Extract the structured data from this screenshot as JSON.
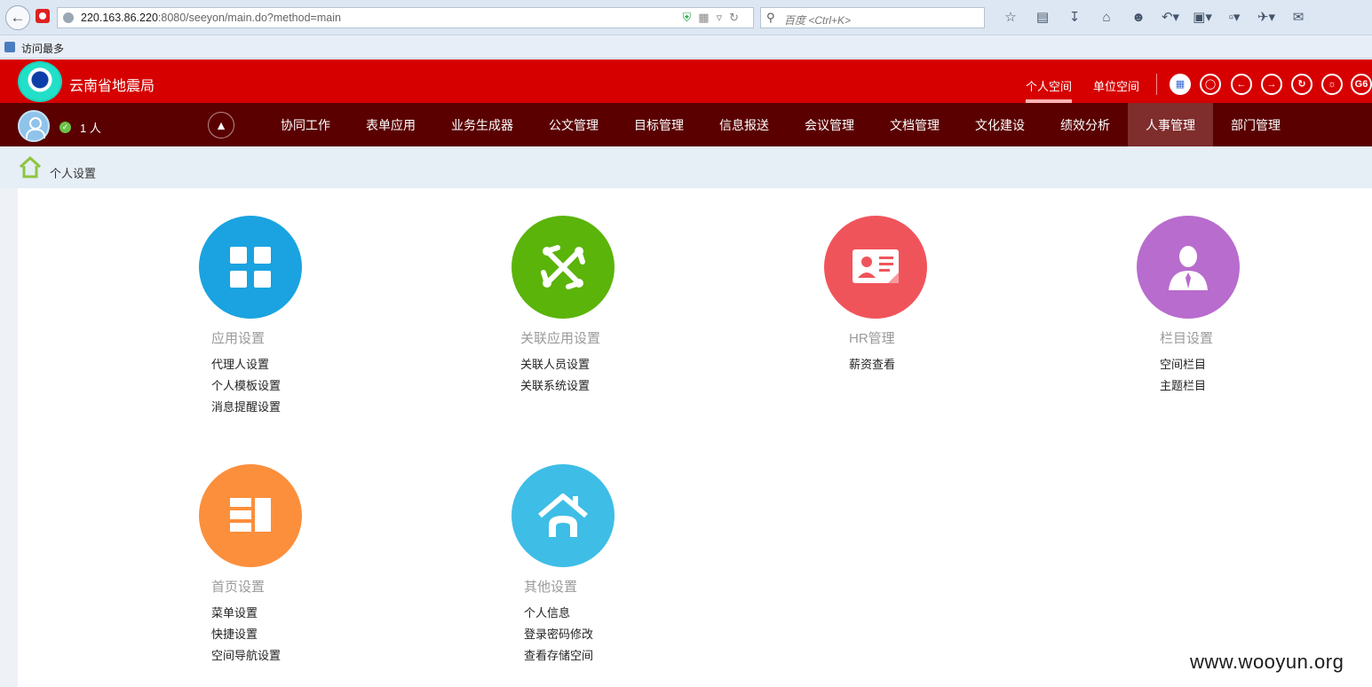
{
  "browser": {
    "url_host": "220.163.86.220",
    "url_rest": ":8080/seeyon/main.do?method=main",
    "search_placeholder": "百度 <Ctrl+K>",
    "bookmark_label": "访问最多"
  },
  "header": {
    "title": "云南省地震局",
    "space_personal": "个人空间",
    "space_unit": "单位空间",
    "last_button": "G6"
  },
  "user_bar": {
    "online_count": "1 人"
  },
  "nav": {
    "items": [
      "协同工作",
      "表单应用",
      "业务生成器",
      "公文管理",
      "目标管理",
      "信息报送",
      "会议管理",
      "文档管理",
      "文化建设",
      "绩效分析",
      "人事管理",
      "部门管理"
    ],
    "active": "人事管理"
  },
  "breadcrumb": {
    "current": "个人设置"
  },
  "tiles": [
    {
      "title": "应用设置",
      "color": "#1aa3e0",
      "icon": "grid-icon",
      "links": [
        "代理人设置",
        "个人模板设置",
        "消息提醒设置"
      ]
    },
    {
      "title": "关联应用设置",
      "color": "#5ab40a",
      "icon": "link-icon",
      "links": [
        "关联人员设置",
        "关联系统设置"
      ]
    },
    {
      "title": "HR管理",
      "color": "#f0545b",
      "icon": "id-card-icon",
      "links": [
        "薪资查看"
      ]
    },
    {
      "title": "栏目设置",
      "color": "#b86ccd",
      "icon": "person-icon",
      "links": [
        "空间栏目",
        "主题栏目"
      ]
    },
    {
      "title": "首页设置",
      "color": "#fc8f3c",
      "icon": "homepage-icon",
      "links": [
        "菜单设置",
        "快捷设置",
        "空间导航设置"
      ]
    },
    {
      "title": "其他设置",
      "color": "#3ebde6",
      "icon": "house-icon",
      "links": [
        "个人信息",
        "登录密码修改",
        "查看存储空间"
      ]
    }
  ],
  "watermark": "www.wooyun.org"
}
